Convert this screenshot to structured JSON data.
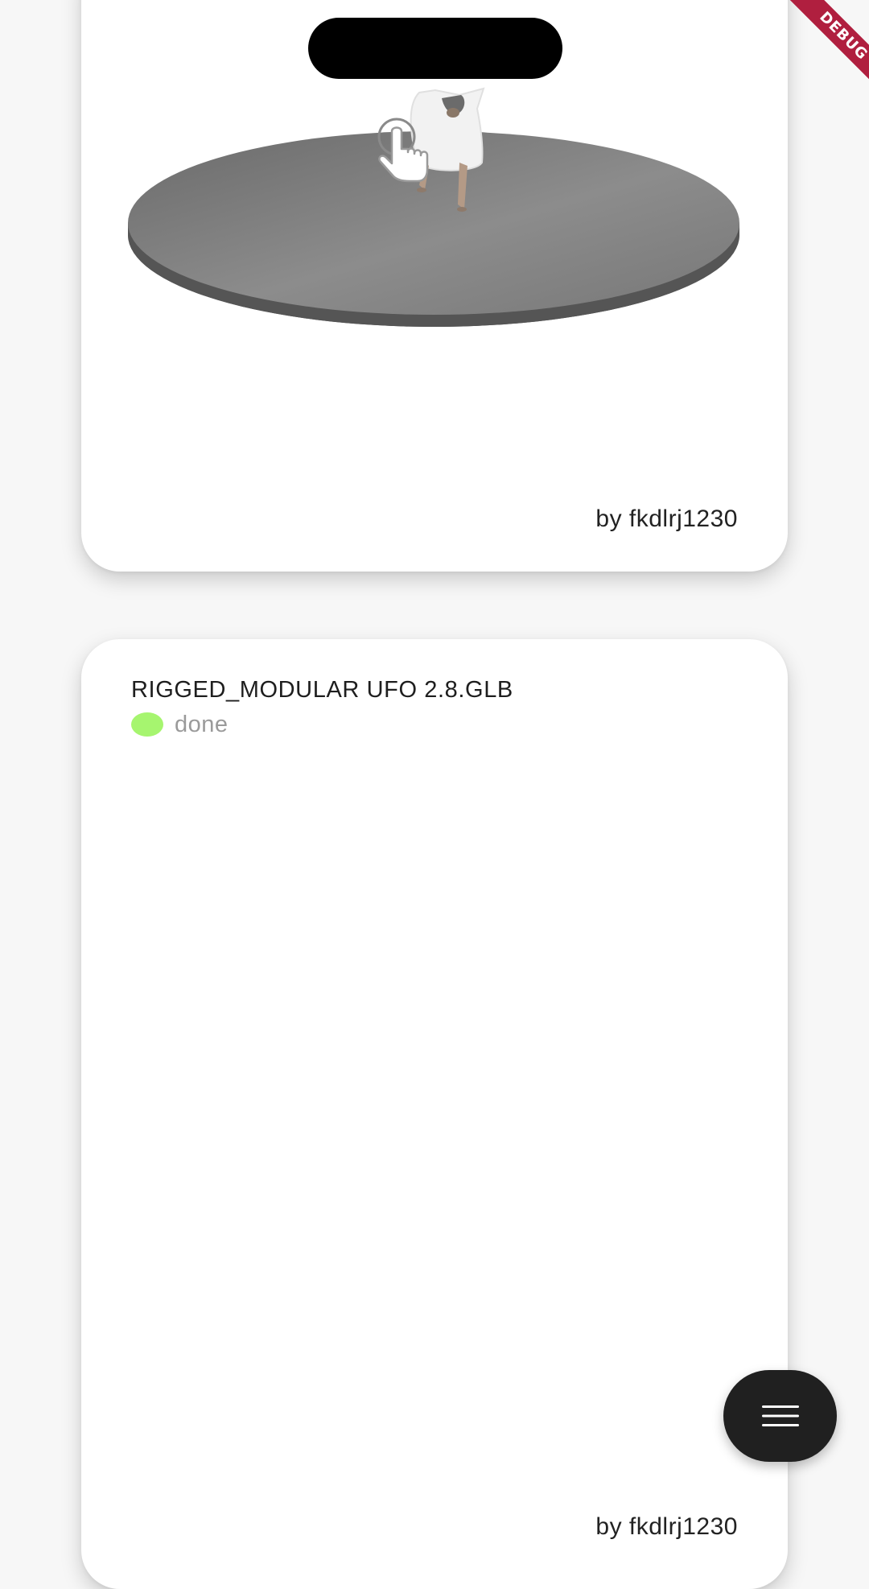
{
  "debug_banner": {
    "label": "DEBUG",
    "color": "#b01f3f"
  },
  "cards": [
    {
      "viewer": {
        "content": "3d-model-preview",
        "platform_color": "#7a7a7a"
      },
      "author": "by fkdlrj1230"
    },
    {
      "title": "RIGGED_MODULAR UFO 2.8.GLB",
      "status": {
        "label": "done",
        "color": "#a6f56f"
      },
      "author": "by fkdlrj1230"
    }
  ],
  "fab": {
    "icon": "menu-icon",
    "color": "#202020"
  }
}
